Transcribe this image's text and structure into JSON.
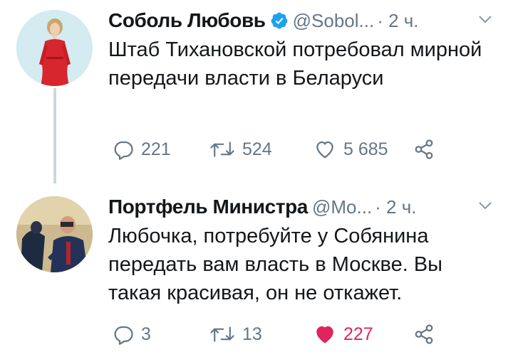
{
  "tweets": [
    {
      "author_name": "Соболь Любовь",
      "verified": true,
      "handle": "@Sobol...",
      "time": "· 2 ч.",
      "text": "Штаб Тихановской потребовал мирной передачи власти в Беларуси",
      "replies": "221",
      "retweets": "524",
      "likes": "5 685",
      "liked": false
    },
    {
      "author_name": "Портфель Министра",
      "verified": false,
      "handle": "@Mo...",
      "time": "· 2 ч.",
      "text": "Любочка, потребуйте у Собянина передать вам власть в Москве. Вы такая красивая, он не откажет.",
      "replies": "3",
      "retweets": "13",
      "likes": "227",
      "liked": true
    }
  ],
  "colors": {
    "text": "#14171a",
    "muted": "#657786",
    "verified": "#1da1f2",
    "like_active": "#e0245e",
    "thread_line": "#ccd6dd"
  },
  "icons": [
    "verified-badge-icon",
    "chevron-down-icon",
    "reply-icon",
    "retweet-icon",
    "like-icon",
    "share-icon"
  ]
}
